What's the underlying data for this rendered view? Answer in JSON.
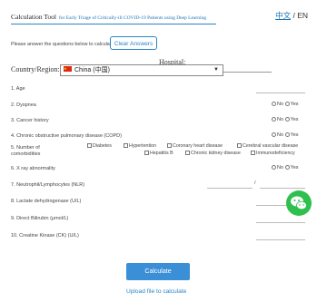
{
  "header": {
    "title": "Calculation Tool",
    "subtitle": "for Early Triage of Critically-ill COVID-19 Patients using Deep Learning",
    "lang_zh": "中文",
    "lang_sep": " / ",
    "lang_en": "EN"
  },
  "form": {
    "instructions": "Please answer the questions below to calculate.",
    "clear_label": "Clear Answers",
    "hospital_label": "Hospital:",
    "country_label": "Country/Region:",
    "country_value": "China (中国)",
    "questions": [
      "1. Age",
      "2. Dyspnea",
      "3. Cancer history",
      "4. Chronic obstructive pulmonary disease (COPD)",
      "5. Number of",
      "comorbidities",
      "6. X ray abnormality",
      "7. Neutrophil/Lymphocytes (NLR)",
      "8. Lactate dehydrogenase  (U/L)",
      "9. Direct Bilirubin  (μmol/L)",
      "10. Creatine Kinase (CK) (U/L)"
    ],
    "no_label": "No",
    "yes_label": "Yes",
    "nlr_sep": "/",
    "comorbidities": [
      "Diabetes",
      "Hypertention",
      "Coronary heart disease",
      "Cerebral vascular disease",
      "Hepatitis B",
      "Chronic kidney disease",
      "Immunodeficiency"
    ],
    "calculate_label": "Calculate",
    "upload_label": "Upload file to calculate"
  },
  "colors": {
    "accent": "#2b86c5",
    "button": "#3a8fd6",
    "wechat": "#2ec04d"
  }
}
